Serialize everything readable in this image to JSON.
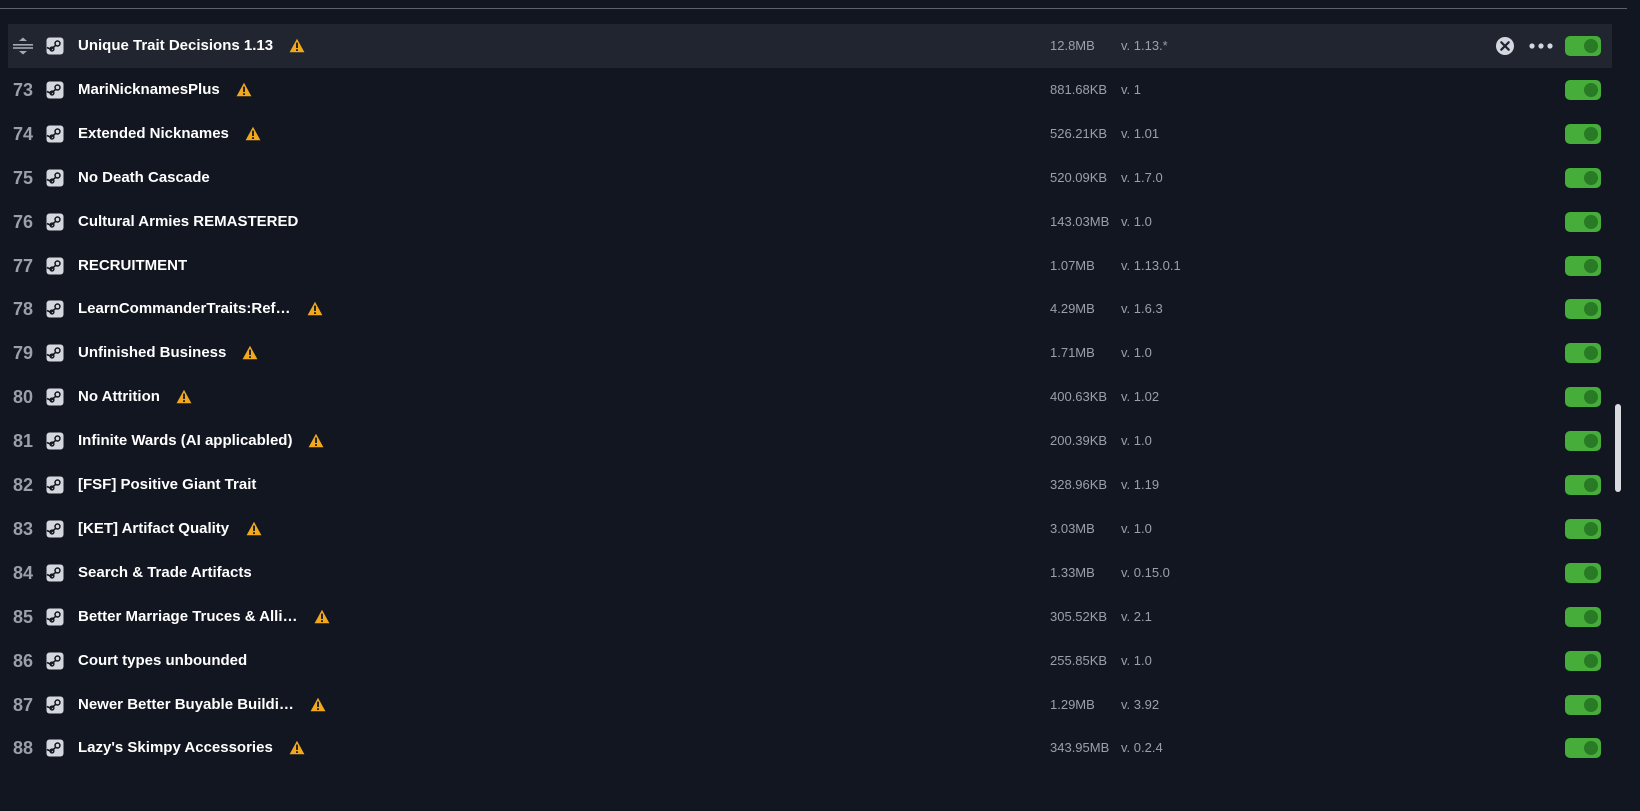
{
  "colors": {
    "background": "#121620",
    "selected_row": "#212530",
    "toggle_on": "#46ad3b",
    "warning": "#f2a81d",
    "muted_text": "#9aa0ab"
  },
  "mods": [
    {
      "index": "",
      "name": "Unique Trait Decisions 1.13",
      "size": "12.8MB",
      "version": "v. 1.13.*",
      "warning": true,
      "enabled": true,
      "selected": true
    },
    {
      "index": "73",
      "name": "MariNicknamesPlus",
      "size": "881.68KB",
      "version": "v. 1",
      "warning": true,
      "enabled": true
    },
    {
      "index": "74",
      "name": "Extended Nicknames",
      "size": "526.21KB",
      "version": "v. 1.01",
      "warning": true,
      "enabled": true
    },
    {
      "index": "75",
      "name": "No Death Cascade",
      "size": "520.09KB",
      "version": "v. 1.7.0",
      "warning": false,
      "enabled": true
    },
    {
      "index": "76",
      "name": "Cultural Armies REMASTERED",
      "size": "143.03MB",
      "version": "v. 1.0",
      "warning": false,
      "enabled": true
    },
    {
      "index": "77",
      "name": "RECRUITMENT",
      "size": "1.07MB",
      "version": "v. 1.13.0.1",
      "warning": false,
      "enabled": true
    },
    {
      "index": "78",
      "name": "LearnCommanderTraits:Ref…",
      "size": "4.29MB",
      "version": "v. 1.6.3",
      "warning": true,
      "enabled": true
    },
    {
      "index": "79",
      "name": "Unfinished Business",
      "size": "1.71MB",
      "version": "v. 1.0",
      "warning": true,
      "enabled": true
    },
    {
      "index": "80",
      "name": "No Attrition",
      "size": "400.63KB",
      "version": "v. 1.02",
      "warning": true,
      "enabled": true
    },
    {
      "index": "81",
      "name": "Infinite Wards (AI applicabled)",
      "size": "200.39KB",
      "version": "v. 1.0",
      "warning": true,
      "enabled": true
    },
    {
      "index": "82",
      "name": "[FSF] Positive Giant Trait",
      "size": "328.96KB",
      "version": "v. 1.19",
      "warning": false,
      "enabled": true
    },
    {
      "index": "83",
      "name": "[KET] Artifact Quality",
      "size": "3.03MB",
      "version": "v. 1.0",
      "warning": true,
      "enabled": true
    },
    {
      "index": "84",
      "name": "Search & Trade Artifacts",
      "size": "1.33MB",
      "version": "v. 0.15.0",
      "warning": false,
      "enabled": true
    },
    {
      "index": "85",
      "name": "Better Marriage Truces & Alli…",
      "size": "305.52KB",
      "version": "v. 2.1",
      "warning": true,
      "enabled": true
    },
    {
      "index": "86",
      "name": "Court types unbounded",
      "size": "255.85KB",
      "version": "v. 1.0",
      "warning": false,
      "enabled": true
    },
    {
      "index": "87",
      "name": "Newer Better Buyable Buildi…",
      "size": "1.29MB",
      "version": "v. 3.92",
      "warning": true,
      "enabled": true
    },
    {
      "index": "88",
      "name": "Lazy's Skimpy Accessories",
      "size": "343.95MB",
      "version": "v. 0.2.4",
      "warning": true,
      "enabled": true
    }
  ],
  "scrollbar": {
    "position_fraction": 0.6
  }
}
